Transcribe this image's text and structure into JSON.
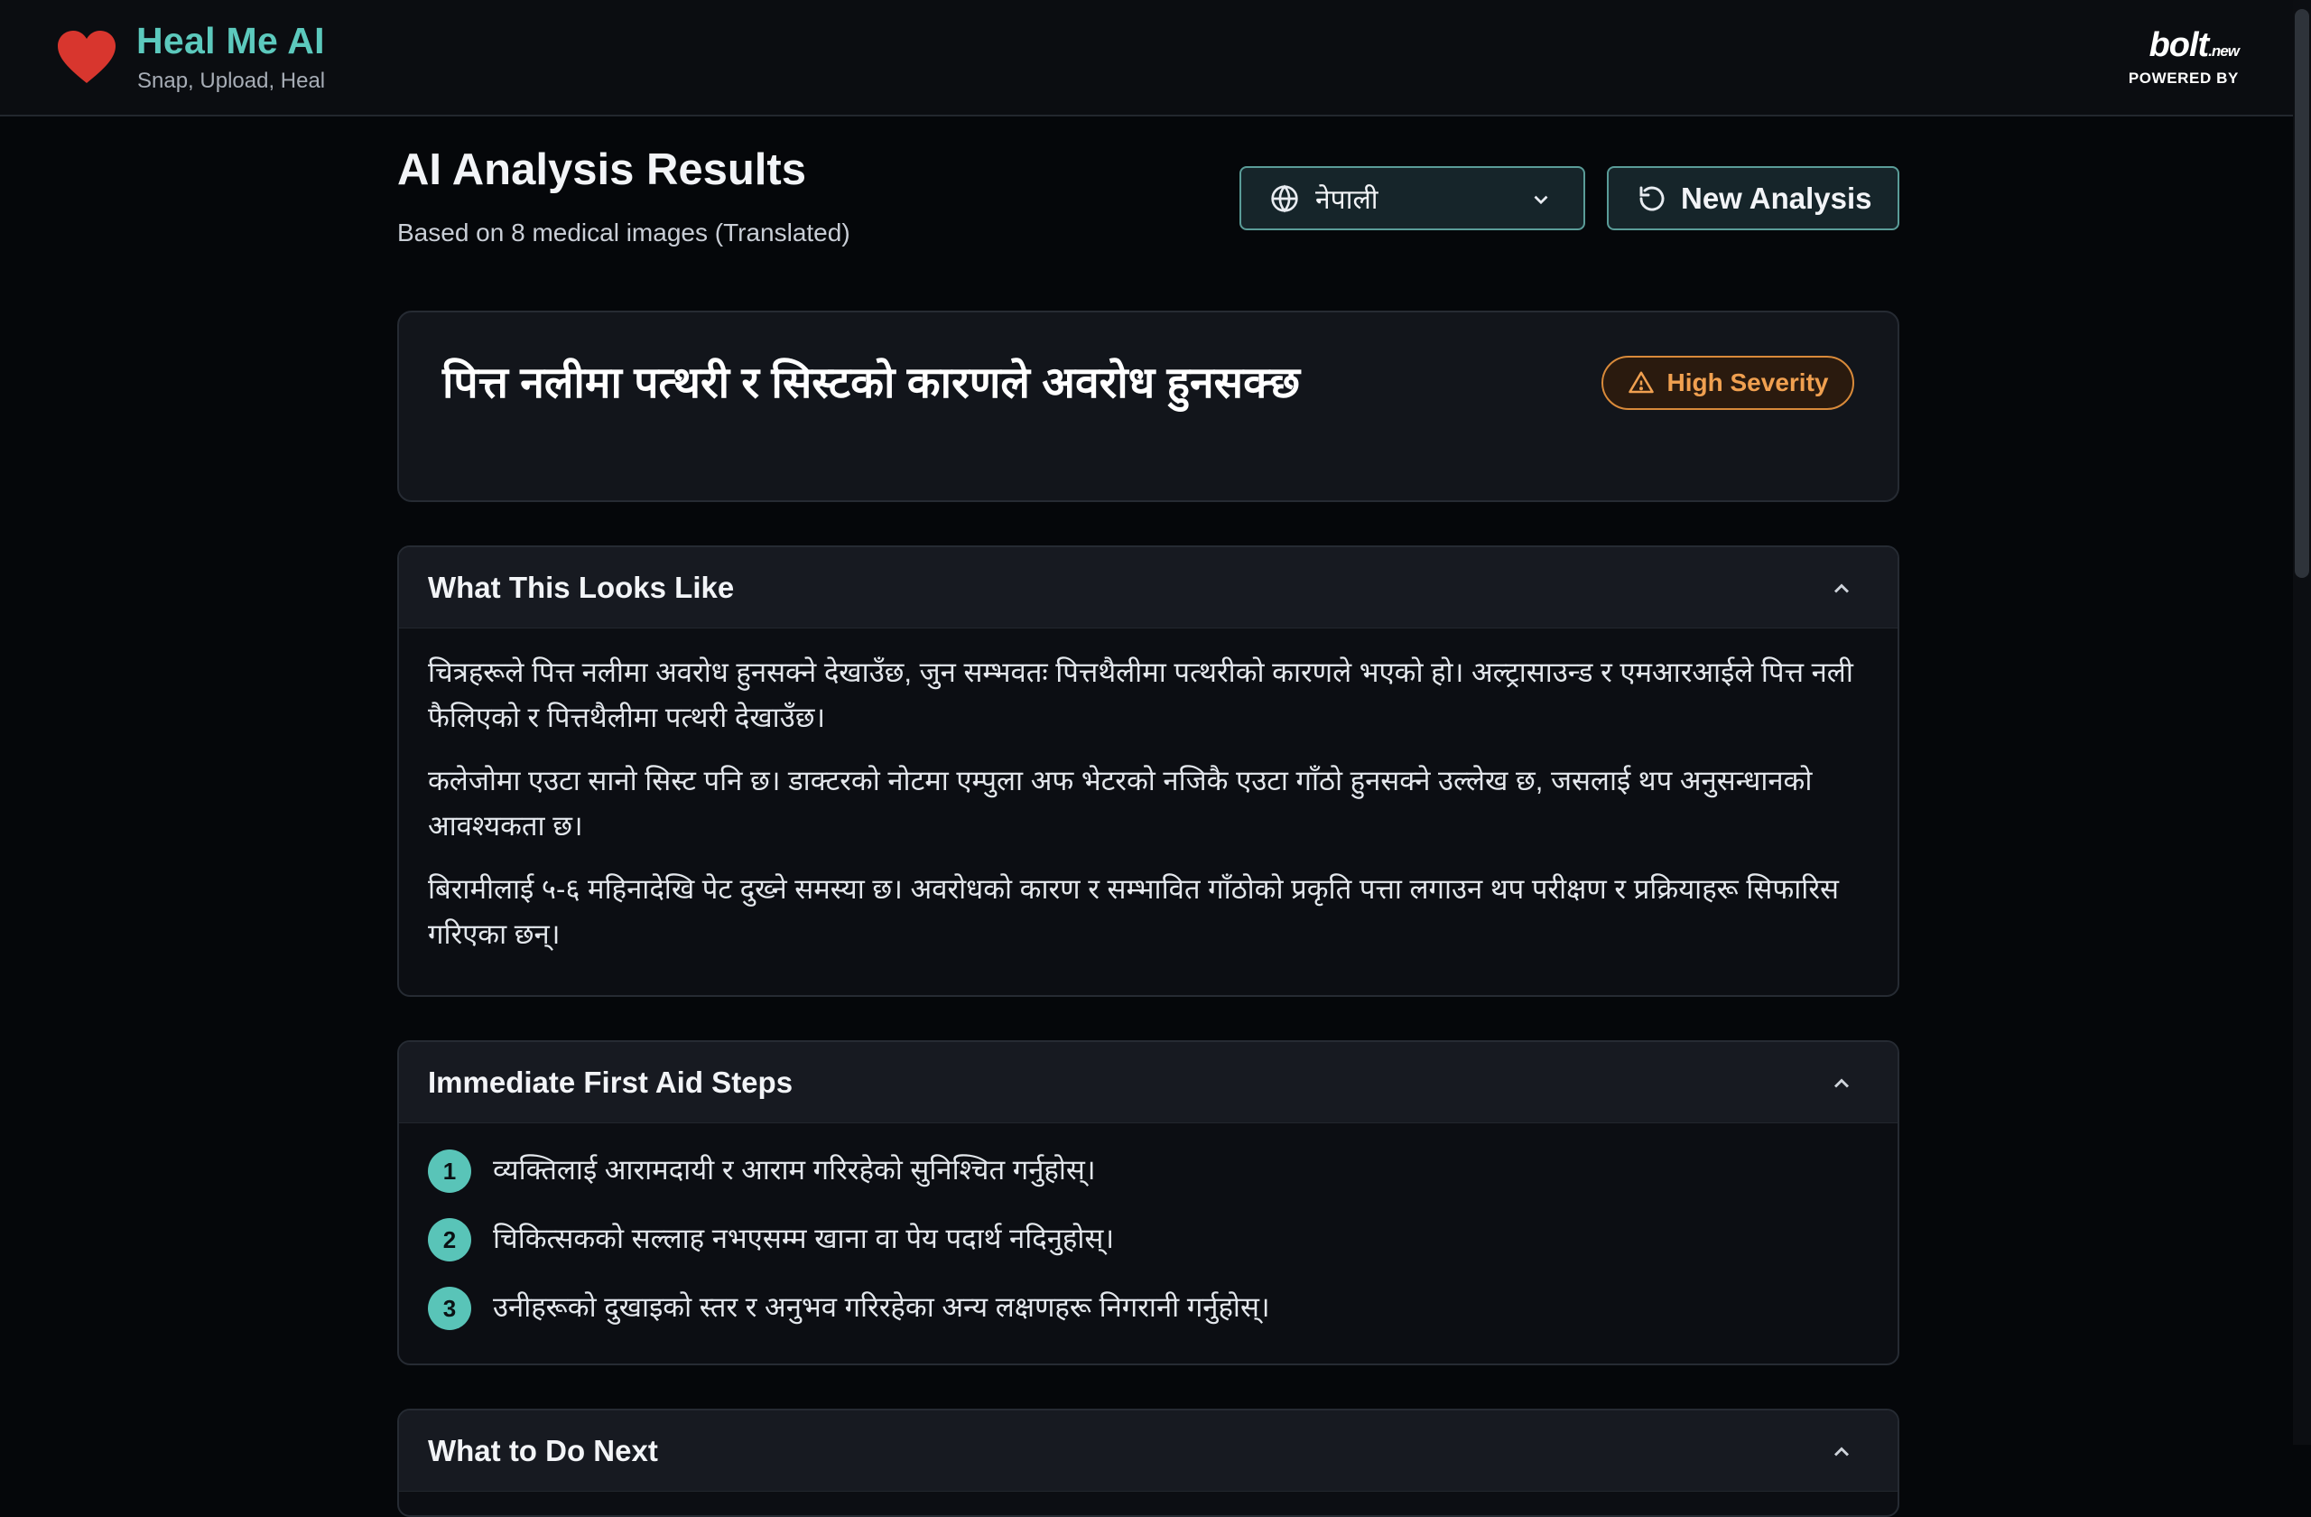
{
  "header": {
    "app_name": "Heal Me AI",
    "tagline": "Snap, Upload, Heal",
    "powered_by": {
      "logo_text": "bolt",
      "logo_suffix": ".new",
      "label": "POWERED BY"
    }
  },
  "results": {
    "title": "AI Analysis Results",
    "subtitle": "Based on 8 medical images (Translated)",
    "language_select": {
      "value": "नेपाली",
      "icon": "globe-icon"
    },
    "new_analysis_label": "New Analysis"
  },
  "diagnosis": {
    "title": "पित्त नलीमा पत्थरी र सिस्टको कारणले अवरोध हुनसक्छ",
    "severity": "High Severity",
    "severity_color": "#f0a050"
  },
  "sections": {
    "looks_like": {
      "label": "What This Looks Like",
      "paragraphs": [
        "चित्रहरूले पित्त नलीमा अवरोध हुनसक्ने देखाउँछ, जुन सम्भवतः पित्तथैलीमा पत्थरीको कारणले भएको हो। अल्ट्रासाउन्ड र एमआरआईले पित्त नली फैलिएको र पित्तथैलीमा पत्थरी देखाउँछ।",
        "कलेजोमा एउटा सानो सिस्ट पनि छ। डाक्टरको नोटमा एम्पुला अफ भेटरको नजिकै एउटा गाँठो हुनसक्ने उल्लेख छ, जसलाई थप अनुसन्धानको आवश्यकता छ।",
        "बिरामीलाई ५-६ महिनादेखि पेट दुख्ने समस्या छ। अवरोधको कारण र सम्भावित गाँठोको प्रकृति पत्ता लगाउन थप परीक्षण र प्रक्रियाहरू सिफारिस गरिएका छन्।"
      ]
    },
    "first_aid": {
      "label": "Immediate First Aid Steps",
      "steps": [
        {
          "num": "1",
          "text": "व्यक्तिलाई आरामदायी र आराम गरिरहेको सुनिश्चित गर्नुहोस्।"
        },
        {
          "num": "2",
          "text": "चिकित्सकको सल्लाह नभएसम्म खाना वा पेय पदार्थ नदिनुहोस्।"
        },
        {
          "num": "3",
          "text": "उनीहरूको दुखाइको स्तर र अनुभव गरिरहेका अन्य लक्षणहरू निगरानी गर्नुहोस्।"
        }
      ]
    },
    "next": {
      "label": "What to Do Next"
    }
  },
  "colors": {
    "accent": "#5cc9bd",
    "background": "#05070a",
    "card": "#12151b",
    "severity_border": "#d98a3a"
  }
}
